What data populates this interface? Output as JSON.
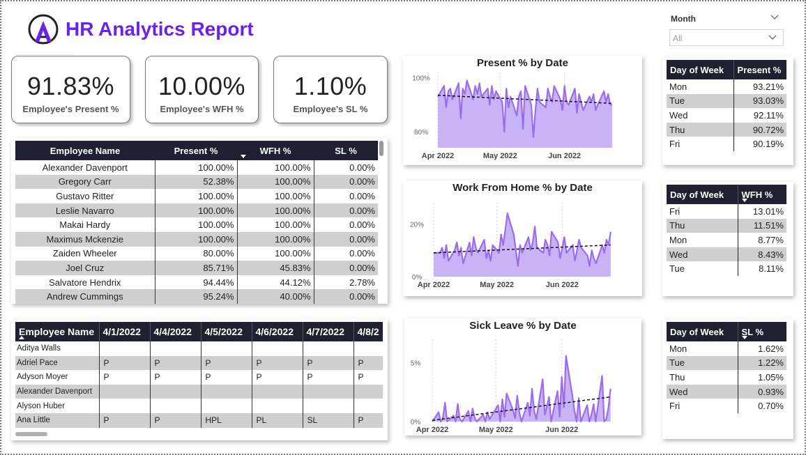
{
  "header": {
    "title": "HR Analytics Report",
    "logo_icon": "a-letter-logo-icon"
  },
  "slicer": {
    "label": "Month",
    "value": "All"
  },
  "kpis": [
    {
      "value": "91.83%",
      "label": "Employee's Present %"
    },
    {
      "value": "10.00%",
      "label": "Employee's WFH %"
    },
    {
      "value": "1.10%",
      "label": "Employee's SL %"
    }
  ],
  "employee_table": {
    "headers": [
      "Employee Name",
      "Present %",
      "WFH %",
      "SL %"
    ],
    "rows": [
      [
        "Alexander Davenport",
        "100.00%",
        "100.00%",
        "0.00%"
      ],
      [
        "Gregory Carr",
        "52.38%",
        "100.00%",
        "0.00%"
      ],
      [
        "Gustavo Ritter",
        "100.00%",
        "100.00%",
        "0.00%"
      ],
      [
        "Leslie Navarro",
        "100.00%",
        "100.00%",
        "0.00%"
      ],
      [
        "Makai Hardy",
        "100.00%",
        "100.00%",
        "0.00%"
      ],
      [
        "Maximus Mckenzie",
        "100.00%",
        "100.00%",
        "0.00%"
      ],
      [
        "Zaiden Wheeler",
        "80.00%",
        "100.00%",
        "0.00%"
      ],
      [
        "Joel Cruz",
        "85.71%",
        "45.83%",
        "0.00%"
      ],
      [
        "Salvatore Hendrix",
        "94.44%",
        "44.12%",
        "2.78%"
      ],
      [
        "Andrew Cummings",
        "95.24%",
        "40.00%",
        "0.00%"
      ]
    ]
  },
  "attendance_table": {
    "headers": [
      "Employee Name",
      "4/1/2022",
      "4/4/2022",
      "4/5/2022",
      "4/6/2022",
      "4/7/2022",
      "4/8/2"
    ],
    "rows": [
      [
        "Aditya Walls",
        "",
        "",
        "",
        "",
        "",
        ""
      ],
      [
        "Adriel Pace",
        "P",
        "P",
        "P",
        "P",
        "P",
        "P"
      ],
      [
        "Adyson Moyer",
        "P",
        "P",
        "P",
        "P",
        "P",
        "P"
      ],
      [
        "Alexander Davenport",
        "",
        "",
        "",
        "",
        "",
        ""
      ],
      [
        "Alyson Huber",
        "",
        "",
        "",
        "",
        "",
        ""
      ],
      [
        "Ana Little",
        "P",
        "P",
        "HPL",
        "PL",
        "SL",
        "P"
      ]
    ]
  },
  "chart_data": [
    {
      "type": "area",
      "title": "Present % by Date",
      "x_ticks": [
        "Apr 2022",
        "May 2022",
        "Jun 2022"
      ],
      "y_ticks": [
        "100%",
        "80%"
      ],
      "ylim": [
        74,
        102
      ],
      "y_unit": "%",
      "x_range": [
        "2022-04-01",
        "2022-06-30"
      ],
      "trendline": {
        "from": 93.5,
        "to": 90.5,
        "style": "dashed"
      },
      "color": "#9b6cf0",
      "fill": "#c8b3f6",
      "points": [
        [
          "2022-04-01",
          93
        ],
        [
          "2022-04-04",
          97
        ],
        [
          "2022-04-05",
          89
        ],
        [
          "2022-04-06",
          95
        ],
        [
          "2022-04-07",
          96
        ],
        [
          "2022-04-08",
          92
        ],
        [
          "2022-04-11",
          98
        ],
        [
          "2022-04-12",
          85
        ],
        [
          "2022-04-13",
          96
        ],
        [
          "2022-04-14",
          94
        ],
        [
          "2022-04-15",
          99
        ],
        [
          "2022-04-18",
          92
        ],
        [
          "2022-04-19",
          97
        ],
        [
          "2022-04-20",
          94
        ],
        [
          "2022-04-21",
          98
        ],
        [
          "2022-04-22",
          93
        ],
        [
          "2022-04-25",
          96
        ],
        [
          "2022-04-26",
          90
        ],
        [
          "2022-04-27",
          97
        ],
        [
          "2022-04-28",
          92
        ],
        [
          "2022-04-29",
          95
        ],
        [
          "2022-05-02",
          91
        ],
        [
          "2022-05-03",
          80
        ],
        [
          "2022-05-04",
          96
        ],
        [
          "2022-05-05",
          89
        ],
        [
          "2022-05-06",
          93
        ],
        [
          "2022-05-09",
          86
        ],
        [
          "2022-05-10",
          93
        ],
        [
          "2022-05-11",
          95
        ],
        [
          "2022-05-12",
          81
        ],
        [
          "2022-05-13",
          97
        ],
        [
          "2022-05-16",
          90
        ],
        [
          "2022-05-17",
          78
        ],
        [
          "2022-05-18",
          88
        ],
        [
          "2022-05-19",
          96
        ],
        [
          "2022-05-20",
          91
        ],
        [
          "2022-05-23",
          89
        ],
        [
          "2022-05-24",
          96
        ],
        [
          "2022-05-25",
          93
        ],
        [
          "2022-05-26",
          91
        ],
        [
          "2022-05-27",
          97
        ],
        [
          "2022-05-30",
          92
        ],
        [
          "2022-05-31",
          88
        ],
        [
          "2022-06-01",
          97
        ],
        [
          "2022-06-02",
          91
        ],
        [
          "2022-06-03",
          90
        ],
        [
          "2022-06-06",
          96
        ],
        [
          "2022-06-07",
          87
        ],
        [
          "2022-06-08",
          94
        ],
        [
          "2022-06-09",
          91
        ],
        [
          "2022-06-10",
          88
        ],
        [
          "2022-06-13",
          93
        ],
        [
          "2022-06-14",
          91
        ],
        [
          "2022-06-15",
          94
        ],
        [
          "2022-06-16",
          88
        ],
        [
          "2022-06-17",
          90
        ],
        [
          "2022-06-20",
          95
        ],
        [
          "2022-06-21",
          91
        ],
        [
          "2022-06-22",
          94
        ],
        [
          "2022-06-23",
          90
        ],
        [
          "2022-06-24",
          90
        ]
      ]
    },
    {
      "type": "area",
      "title": "Work From Home % by Date",
      "x_ticks": [
        "Apr 2022",
        "May 2022",
        "Jun 2022"
      ],
      "y_ticks": [
        "20%",
        "0%"
      ],
      "ylim": [
        0,
        28
      ],
      "y_unit": "%",
      "x_range": [
        "2022-04-01",
        "2022-06-30"
      ],
      "trendline": {
        "from": 9,
        "to": 12,
        "style": "dashed"
      },
      "color": "#9b6cf0",
      "fill": "#c8b3f6",
      "points": [
        [
          "2022-04-01",
          9
        ],
        [
          "2022-04-04",
          9
        ],
        [
          "2022-04-05",
          11
        ],
        [
          "2022-04-06",
          7
        ],
        [
          "2022-04-07",
          12
        ],
        [
          "2022-04-08",
          6
        ],
        [
          "2022-04-11",
          10
        ],
        [
          "2022-04-12",
          13
        ],
        [
          "2022-04-13",
          8
        ],
        [
          "2022-04-14",
          11
        ],
        [
          "2022-04-15",
          5
        ],
        [
          "2022-04-18",
          13
        ],
        [
          "2022-04-19",
          8
        ],
        [
          "2022-04-20",
          15
        ],
        [
          "2022-04-21",
          11
        ],
        [
          "2022-04-22",
          9
        ],
        [
          "2022-04-25",
          14
        ],
        [
          "2022-04-26",
          7
        ],
        [
          "2022-04-27",
          10
        ],
        [
          "2022-04-28",
          6
        ],
        [
          "2022-04-29",
          12
        ],
        [
          "2022-05-02",
          9
        ],
        [
          "2022-05-03",
          16
        ],
        [
          "2022-05-04",
          12
        ],
        [
          "2022-05-05",
          18
        ],
        [
          "2022-05-06",
          24
        ],
        [
          "2022-05-09",
          16
        ],
        [
          "2022-05-10",
          10
        ],
        [
          "2022-05-11",
          4
        ],
        [
          "2022-05-12",
          12
        ],
        [
          "2022-05-13",
          9
        ],
        [
          "2022-05-16",
          15
        ],
        [
          "2022-05-17",
          10
        ],
        [
          "2022-05-18",
          13
        ],
        [
          "2022-05-19",
          19
        ],
        [
          "2022-05-20",
          11
        ],
        [
          "2022-05-23",
          9
        ],
        [
          "2022-05-24",
          14
        ],
        [
          "2022-05-25",
          12
        ],
        [
          "2022-05-26",
          8
        ],
        [
          "2022-05-27",
          17
        ],
        [
          "2022-05-30",
          13
        ],
        [
          "2022-05-31",
          7
        ],
        [
          "2022-06-01",
          11
        ],
        [
          "2022-06-02",
          15
        ],
        [
          "2022-06-03",
          9
        ],
        [
          "2022-06-06",
          12
        ],
        [
          "2022-06-07",
          6
        ],
        [
          "2022-06-08",
          10
        ],
        [
          "2022-06-09",
          14
        ],
        [
          "2022-06-10",
          11
        ],
        [
          "2022-06-13",
          8
        ],
        [
          "2022-06-14",
          4
        ],
        [
          "2022-06-15",
          10
        ],
        [
          "2022-06-16",
          7
        ],
        [
          "2022-06-17",
          5
        ],
        [
          "2022-06-20",
          12
        ],
        [
          "2022-06-21",
          9
        ],
        [
          "2022-06-22",
          14
        ],
        [
          "2022-06-23",
          12
        ],
        [
          "2022-06-24",
          17
        ]
      ]
    },
    {
      "type": "area",
      "title": "Sick Leave % by Date",
      "x_ticks": [
        "Apr 2022",
        "May 2022",
        "Jun 2022"
      ],
      "y_ticks": [
        "5%",
        "0%"
      ],
      "ylim": [
        0,
        7
      ],
      "y_unit": "%",
      "x_range": [
        "2022-04-01",
        "2022-06-30"
      ],
      "trendline": {
        "from": 0.1,
        "to": 2.1,
        "style": "dashed"
      },
      "color": "#9b6cf0",
      "fill": "#c8b3f6",
      "points": [
        [
          "2022-04-01",
          0
        ],
        [
          "2022-04-04",
          0.8
        ],
        [
          "2022-04-05",
          0
        ],
        [
          "2022-04-06",
          0.3
        ],
        [
          "2022-04-07",
          1.6
        ],
        [
          "2022-04-08",
          0
        ],
        [
          "2022-04-11",
          0.5
        ],
        [
          "2022-04-12",
          0
        ],
        [
          "2022-04-13",
          1.5
        ],
        [
          "2022-04-14",
          0.2
        ],
        [
          "2022-04-15",
          0
        ],
        [
          "2022-04-18",
          0.9
        ],
        [
          "2022-04-19",
          0
        ],
        [
          "2022-04-20",
          1.1
        ],
        [
          "2022-04-21",
          0.3
        ],
        [
          "2022-04-22",
          0
        ],
        [
          "2022-04-25",
          0.6
        ],
        [
          "2022-04-26",
          0
        ],
        [
          "2022-04-27",
          0.8
        ],
        [
          "2022-04-28",
          0.2
        ],
        [
          "2022-04-29",
          0.5
        ],
        [
          "2022-05-02",
          1.4
        ],
        [
          "2022-05-03",
          0
        ],
        [
          "2022-05-04",
          1.9
        ],
        [
          "2022-05-05",
          0.4
        ],
        [
          "2022-05-06",
          2.4
        ],
        [
          "2022-05-09",
          1.0
        ],
        [
          "2022-05-10",
          0.3
        ],
        [
          "2022-05-11",
          2.2
        ],
        [
          "2022-05-12",
          0.8
        ],
        [
          "2022-05-13",
          0
        ],
        [
          "2022-05-16",
          1.6
        ],
        [
          "2022-05-17",
          0.5
        ],
        [
          "2022-05-18",
          2.8
        ],
        [
          "2022-05-19",
          0.9
        ],
        [
          "2022-05-20",
          0.2
        ],
        [
          "2022-05-23",
          3.6
        ],
        [
          "2022-05-24",
          0.6
        ],
        [
          "2022-05-25",
          1.3
        ],
        [
          "2022-05-26",
          2.1
        ],
        [
          "2022-05-27",
          0
        ],
        [
          "2022-05-30",
          2.6
        ],
        [
          "2022-05-31",
          0.4
        ],
        [
          "2022-06-01",
          3.8
        ],
        [
          "2022-06-02",
          1.2
        ],
        [
          "2022-06-03",
          5.6
        ],
        [
          "2022-06-06",
          2.2
        ],
        [
          "2022-06-07",
          0.9
        ],
        [
          "2022-06-08",
          0
        ],
        [
          "2022-06-09",
          2.0
        ],
        [
          "2022-06-10",
          0
        ],
        [
          "2022-06-13",
          1.4
        ],
        [
          "2022-06-14",
          0
        ],
        [
          "2022-06-15",
          0.6
        ],
        [
          "2022-06-16",
          1.5
        ],
        [
          "2022-06-17",
          0
        ],
        [
          "2022-06-20",
          3.9
        ],
        [
          "2022-06-21",
          0
        ],
        [
          "2022-06-22",
          0.2
        ],
        [
          "2022-06-23",
          1.2
        ],
        [
          "2022-06-24",
          2.8
        ]
      ]
    }
  ],
  "dow_tables": [
    {
      "headers": [
        "Day of Week",
        "Present %"
      ],
      "sorted_column": 1,
      "sort_direction": "none",
      "rows": [
        [
          "Mon",
          "93.21%"
        ],
        [
          "Tue",
          "93.03%"
        ],
        [
          "Wed",
          "92.11%"
        ],
        [
          "Thu",
          "90.72%"
        ],
        [
          "Fri",
          "90.19%"
        ]
      ]
    },
    {
      "headers": [
        "Day of Week",
        "WFH %"
      ],
      "sorted_column": 1,
      "sort_direction": "desc",
      "rows": [
        [
          "Fri",
          "13.01%"
        ],
        [
          "Thu",
          "11.51%"
        ],
        [
          "Mon",
          "8.77%"
        ],
        [
          "Wed",
          "8.43%"
        ],
        [
          "Tue",
          "8.11%"
        ]
      ]
    },
    {
      "headers": [
        "Day of Week",
        "SL %"
      ],
      "sorted_column": 1,
      "sort_direction": "desc",
      "rows": [
        [
          "Mon",
          "1.62%"
        ],
        [
          "Tue",
          "1.22%"
        ],
        [
          "Thu",
          "1.05%"
        ],
        [
          "Wed",
          "0.93%"
        ],
        [
          "Fri",
          "0.70%"
        ]
      ]
    }
  ],
  "colors": {
    "accent": "#6a22e8",
    "header_bg": "#1f2030",
    "row_alt": "#cfcfcf",
    "line": "#9b6cf0",
    "area": "#c8b3f6"
  }
}
